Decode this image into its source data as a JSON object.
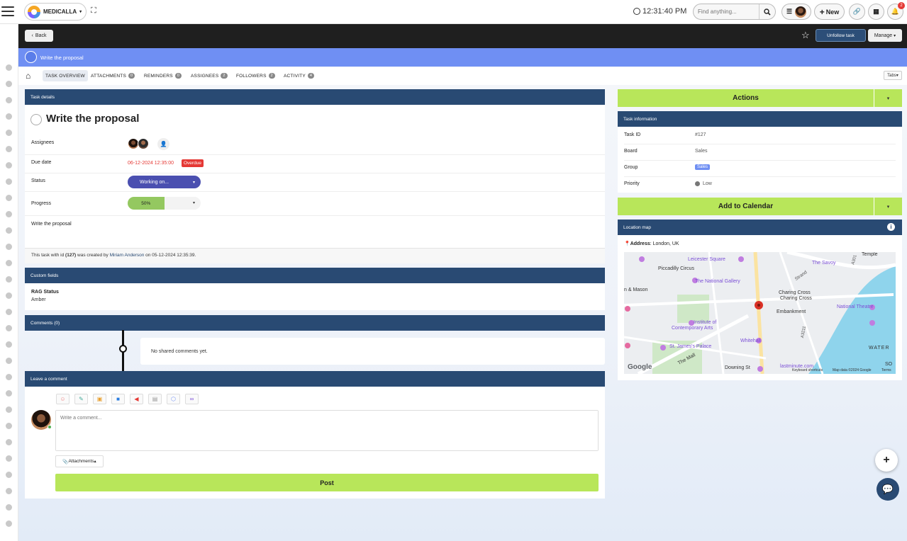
{
  "topbar": {
    "brand": "MEDICALLA",
    "time": "12:31:40 PM",
    "search_placeholder": "Find anything...",
    "new_label": "New",
    "notification_count": "2"
  },
  "toolbar": {
    "back_label": "Back",
    "unfollow_label": "Unfollow task",
    "manage_label": "Manage"
  },
  "task_header": {
    "title": "Write the proposal"
  },
  "tabs": [
    {
      "label": "TASK OVERVIEW",
      "count": ""
    },
    {
      "label": "ATTACHMENTS",
      "count": "0"
    },
    {
      "label": "REMINDERS",
      "count": "0"
    },
    {
      "label": "ASSIGNEES",
      "count": "2"
    },
    {
      "label": "FOLLOWERS",
      "count": "2"
    },
    {
      "label": "ACTIVITY",
      "count": "4"
    }
  ],
  "tabs_button": "Tabs",
  "task_details": {
    "header": "Task details",
    "title": "Write the proposal",
    "assignees_label": "Assignees",
    "due_label": "Due date",
    "due_value": "06-12-2024 12:35:00",
    "overdue_badge": "Overdue",
    "status_label": "Status",
    "status_value": "Working on...",
    "progress_label": "Progress",
    "progress_value": "50%",
    "progress_fraction": 0.5,
    "description": "Write the proposal",
    "footer_prefix": "This task with id ",
    "footer_id": "(127)",
    "footer_mid": " was created by ",
    "footer_user": "Miriam Anderson",
    "footer_suffix": " on 05-12-2024 12:35:39."
  },
  "custom_fields": {
    "header": "Custom fields",
    "field_label": "RAG Status",
    "field_value": "Amber"
  },
  "comments": {
    "header": "Comments (0)",
    "empty_text": "No shared comments yet."
  },
  "leave_comment": {
    "header": "Leave a comment",
    "placeholder": "Write a comment...",
    "attachments_label": "Attachments",
    "post_label": "Post"
  },
  "actions": {
    "label": "Actions"
  },
  "task_info": {
    "header": "Task information",
    "rows": [
      {
        "label": "Task ID",
        "value": "#127"
      },
      {
        "label": "Board",
        "value": "Sales"
      },
      {
        "label": "Group",
        "value": "Sales"
      },
      {
        "label": "Priority",
        "value": "Low"
      }
    ]
  },
  "calendar": {
    "label": "Add to Calendar"
  },
  "location": {
    "header": "Location map",
    "address_label": "Address",
    "address_value": ": London, UK",
    "map_labels": [
      "Leicester Square",
      "The Savoy",
      "Temple",
      "Piccadilly Circus",
      "The National Gallery",
      "Strand",
      "Charing Cross",
      "Charing Cross",
      "n & Mason",
      "Embankment",
      "National Theatre",
      "Institute of",
      "Contemporary Arts",
      "Whitehall",
      "St. James's Palace",
      "The Mall",
      "Downing St",
      "lastminute.com",
      "WATER",
      "SO",
      "A301",
      "A3211"
    ],
    "google": "Google",
    "attribution_1": "Keyboard shortcuts",
    "attribution_2": "Map data ©2024 Google",
    "attribution_3": "Terms"
  },
  "colors": {
    "accent_blue": "#6f8ff3",
    "panel_header": "#294a73",
    "action_green": "#b8e65a",
    "status_purple": "#4a4fb0",
    "overdue_red": "#e53935"
  }
}
